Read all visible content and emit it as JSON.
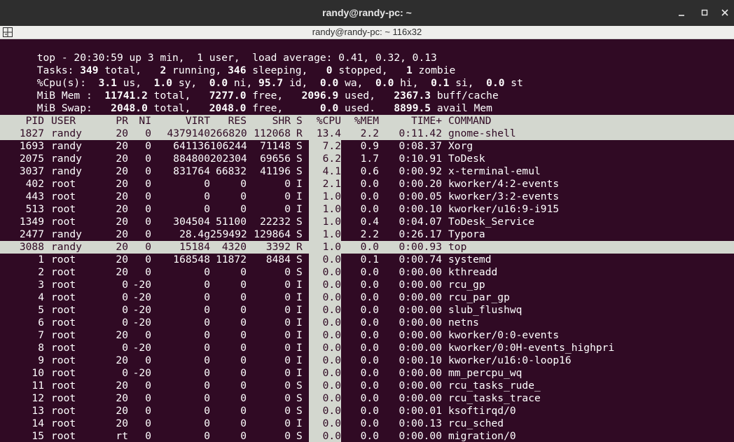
{
  "window": {
    "title": "randy@randy-pc: ~",
    "tab_title": "randy@randy-pc: ~ 116x32"
  },
  "summary": {
    "line1": "top - 20:30:59 up 3 min,  1 user,  load average: 0.41, 0.32, 0.13",
    "tasks": {
      "label": "Tasks:",
      "total": "349",
      "total_label": " total,   ",
      "running": "2",
      "running_label": " running, ",
      "sleeping": "346",
      "sleeping_label": " sleeping,   ",
      "stopped": "0",
      "stopped_label": " stopped,   ",
      "zombie": "1",
      "zombie_label": " zombie"
    },
    "cpu": {
      "label": "%Cpu(s):  ",
      "us": "3.1",
      "us_label": " us,  ",
      "sy": "1.0",
      "sy_label": " sy,  ",
      "ni": "0.0",
      "ni_label": " ni, ",
      "id": "95.7",
      "id_label": " id,  ",
      "wa": "0.0",
      "wa_label": " wa,  ",
      "hi": "0.0",
      "hi_label": " hi,  ",
      "si": "0.1",
      "si_label": " si,  ",
      "st": "0.0",
      "st_label": " st"
    },
    "mem": {
      "label": "MiB Mem :  ",
      "total": "11741.2",
      "total_label": " total,   ",
      "free": "7277.0",
      "free_label": " free,   ",
      "used": "2096.9",
      "used_label": " used,   ",
      "buff": "2367.3",
      "buff_label": " buff/cache"
    },
    "swap": {
      "label": "MiB Swap:   ",
      "total": "2048.0",
      "total_label": " total,   ",
      "free": "2048.0",
      "free_label": " free,      ",
      "used": "0.0",
      "used_label": " used.   ",
      "avail": "8899.5",
      "avail_label": " avail Mem"
    }
  },
  "table": {
    "headers": [
      "PID",
      "USER",
      "PR",
      "NI",
      "VIRT",
      "RES",
      "SHR",
      "S",
      "%CPU",
      "%MEM",
      "TIME+",
      "COMMAND"
    ],
    "rows": [
      [
        "1827",
        "randy",
        "20",
        "0",
        "4379140",
        "266820",
        "112068",
        "R",
        "13.4",
        "2.2",
        "0:11.42",
        "gnome-shell"
      ],
      [
        "1693",
        "randy",
        "20",
        "0",
        "641136",
        "106244",
        "71148",
        "S",
        "7.2",
        "0.9",
        "0:08.37",
        "Xorg"
      ],
      [
        "2075",
        "randy",
        "20",
        "0",
        "884800",
        "202304",
        "69656",
        "S",
        "6.2",
        "1.7",
        "0:10.91",
        "ToDesk"
      ],
      [
        "3037",
        "randy",
        "20",
        "0",
        "831764",
        "66832",
        "41196",
        "S",
        "4.1",
        "0.6",
        "0:00.92",
        "x-terminal-emul"
      ],
      [
        "402",
        "root",
        "20",
        "0",
        "0",
        "0",
        "0",
        "I",
        "2.1",
        "0.0",
        "0:00.20",
        "kworker/4:2-events"
      ],
      [
        "443",
        "root",
        "20",
        "0",
        "0",
        "0",
        "0",
        "I",
        "1.0",
        "0.0",
        "0:00.05",
        "kworker/3:2-events"
      ],
      [
        "513",
        "root",
        "20",
        "0",
        "0",
        "0",
        "0",
        "I",
        "1.0",
        "0.0",
        "0:00.10",
        "kworker/u16:9-i915"
      ],
      [
        "1349",
        "root",
        "20",
        "0",
        "304504",
        "51100",
        "22232",
        "S",
        "1.0",
        "0.4",
        "0:04.07",
        "ToDesk_Service"
      ],
      [
        "2477",
        "randy",
        "20",
        "0",
        "28.4g",
        "259492",
        "129864",
        "S",
        "1.0",
        "2.2",
        "0:26.17",
        "Typora"
      ],
      [
        "3088",
        "randy",
        "20",
        "0",
        "15184",
        "4320",
        "3392",
        "R",
        "1.0",
        "0.0",
        "0:00.93",
        "top"
      ],
      [
        "1",
        "root",
        "20",
        "0",
        "168548",
        "11872",
        "8484",
        "S",
        "0.0",
        "0.1",
        "0:00.74",
        "systemd"
      ],
      [
        "2",
        "root",
        "20",
        "0",
        "0",
        "0",
        "0",
        "S",
        "0.0",
        "0.0",
        "0:00.00",
        "kthreadd"
      ],
      [
        "3",
        "root",
        "0",
        "-20",
        "0",
        "0",
        "0",
        "I",
        "0.0",
        "0.0",
        "0:00.00",
        "rcu_gp"
      ],
      [
        "4",
        "root",
        "0",
        "-20",
        "0",
        "0",
        "0",
        "I",
        "0.0",
        "0.0",
        "0:00.00",
        "rcu_par_gp"
      ],
      [
        "5",
        "root",
        "0",
        "-20",
        "0",
        "0",
        "0",
        "I",
        "0.0",
        "0.0",
        "0:00.00",
        "slub_flushwq"
      ],
      [
        "6",
        "root",
        "0",
        "-20",
        "0",
        "0",
        "0",
        "I",
        "0.0",
        "0.0",
        "0:00.00",
        "netns"
      ],
      [
        "7",
        "root",
        "20",
        "0",
        "0",
        "0",
        "0",
        "I",
        "0.0",
        "0.0",
        "0:00.00",
        "kworker/0:0-events"
      ],
      [
        "8",
        "root",
        "0",
        "-20",
        "0",
        "0",
        "0",
        "I",
        "0.0",
        "0.0",
        "0:00.00",
        "kworker/0:0H-events_highpri"
      ],
      [
        "9",
        "root",
        "20",
        "0",
        "0",
        "0",
        "0",
        "I",
        "0.0",
        "0.0",
        "0:00.10",
        "kworker/u16:0-loop16"
      ],
      [
        "10",
        "root",
        "0",
        "-20",
        "0",
        "0",
        "0",
        "I",
        "0.0",
        "0.0",
        "0:00.00",
        "mm_percpu_wq"
      ],
      [
        "11",
        "root",
        "20",
        "0",
        "0",
        "0",
        "0",
        "S",
        "0.0",
        "0.0",
        "0:00.00",
        "rcu_tasks_rude_"
      ],
      [
        "12",
        "root",
        "20",
        "0",
        "0",
        "0",
        "0",
        "S",
        "0.0",
        "0.0",
        "0:00.00",
        "rcu_tasks_trace"
      ],
      [
        "13",
        "root",
        "20",
        "0",
        "0",
        "0",
        "0",
        "S",
        "0.0",
        "0.0",
        "0:00.01",
        "ksoftirqd/0"
      ],
      [
        "14",
        "root",
        "20",
        "0",
        "0",
        "0",
        "0",
        "I",
        "0.0",
        "0.0",
        "0:00.13",
        "rcu_sched"
      ],
      [
        "15",
        "root",
        "rt",
        "0",
        "0",
        "0",
        "0",
        "S",
        "0.0",
        "0.0",
        "0:00.00",
        "migration/0"
      ]
    ],
    "highlighted_rows": [
      0,
      9
    ]
  },
  "colors": {
    "terminal_bg": "#300a24",
    "highlight_bg": "#d3d7cf",
    "titlebar_bg": "#2e2e2e"
  },
  "icons": {
    "menu": "terminal-menu-icon",
    "minimize": "minimize-icon",
    "maximize": "maximize-icon",
    "close": "close-icon"
  }
}
